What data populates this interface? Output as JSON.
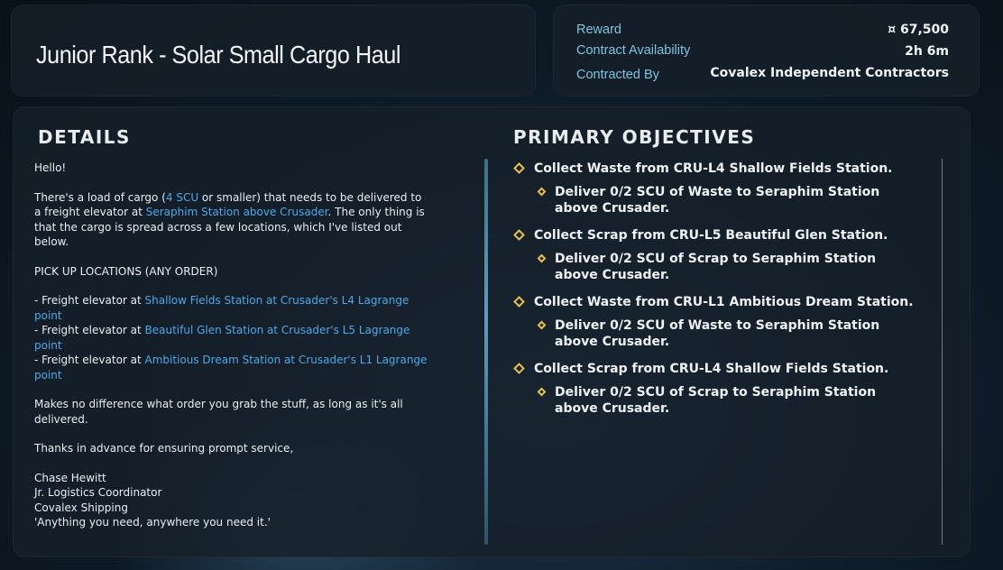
{
  "header": {
    "title": "Junior Rank - Solar Small Cargo Haul"
  },
  "contract_info": {
    "reward_label": "Reward",
    "reward_value": "¤ 67,500",
    "availability_label": "Contract Availability",
    "availability_value": "2h 6m",
    "contracted_by_label": "Contracted By",
    "contracted_by_value": "Covalex Independent Contractors"
  },
  "details": {
    "heading": "DETAILS",
    "greeting": "Hello!",
    "para1_a": "There's a load of cargo (",
    "para1_hl1": "4 SCU",
    "para1_b": " or smaller) that needs to be delivered to a freight elevator at ",
    "para1_hl2": "Seraphim Station above Crusader",
    "para1_c": ". The only thing is that the cargo is spread across a few locations, which I've listed out below.",
    "pickup_heading": "PICK UP LOCATIONS (ANY ORDER)",
    "pickups": [
      {
        "prefix": "- Freight elevator at ",
        "location": "Shallow Fields Station at Crusader's L4 Lagrange point"
      },
      {
        "prefix": "- Freight elevator at ",
        "location": "Beautiful Glen Station at Crusader's L5 Lagrange point"
      },
      {
        "prefix": "- Freight elevator at ",
        "location": "Ambitious Dream Station at Crusader's L1 Lagrange point"
      }
    ],
    "para2": "Makes no difference what order you grab the stuff, as long as it's all delivered.",
    "para3": "Thanks in advance for ensuring prompt service,",
    "signature": [
      "Chase Hewitt",
      "Jr. Logistics Coordinator",
      "Covalex Shipping",
      "'Anything you need, anywhere you need it.'"
    ]
  },
  "objectives": {
    "heading": "PRIMARY OBJECTIVES",
    "items": [
      {
        "main": "Collect Waste from CRU-L4 Shallow Fields Station.",
        "sub": "Deliver 0/2 SCU of Waste to Seraphim Station above Crusader."
      },
      {
        "main": "Collect Scrap from CRU-L5 Beautiful Glen Station.",
        "sub": "Deliver 0/2 SCU of Scrap to Seraphim Station above Crusader."
      },
      {
        "main": "Collect Waste from CRU-L1 Ambitious Dream Station.",
        "sub": "Deliver 0/2 SCU of Waste to Seraphim Station above Crusader."
      },
      {
        "main": "Collect Scrap from CRU-L4 Shallow Fields Station.",
        "sub": "Deliver 0/2 SCU of Scrap to Seraphim Station above Crusader."
      }
    ]
  },
  "colors": {
    "highlight": "#4ea8e8",
    "objective_marker": "#e7c24a",
    "label": "#7fc3e0"
  }
}
